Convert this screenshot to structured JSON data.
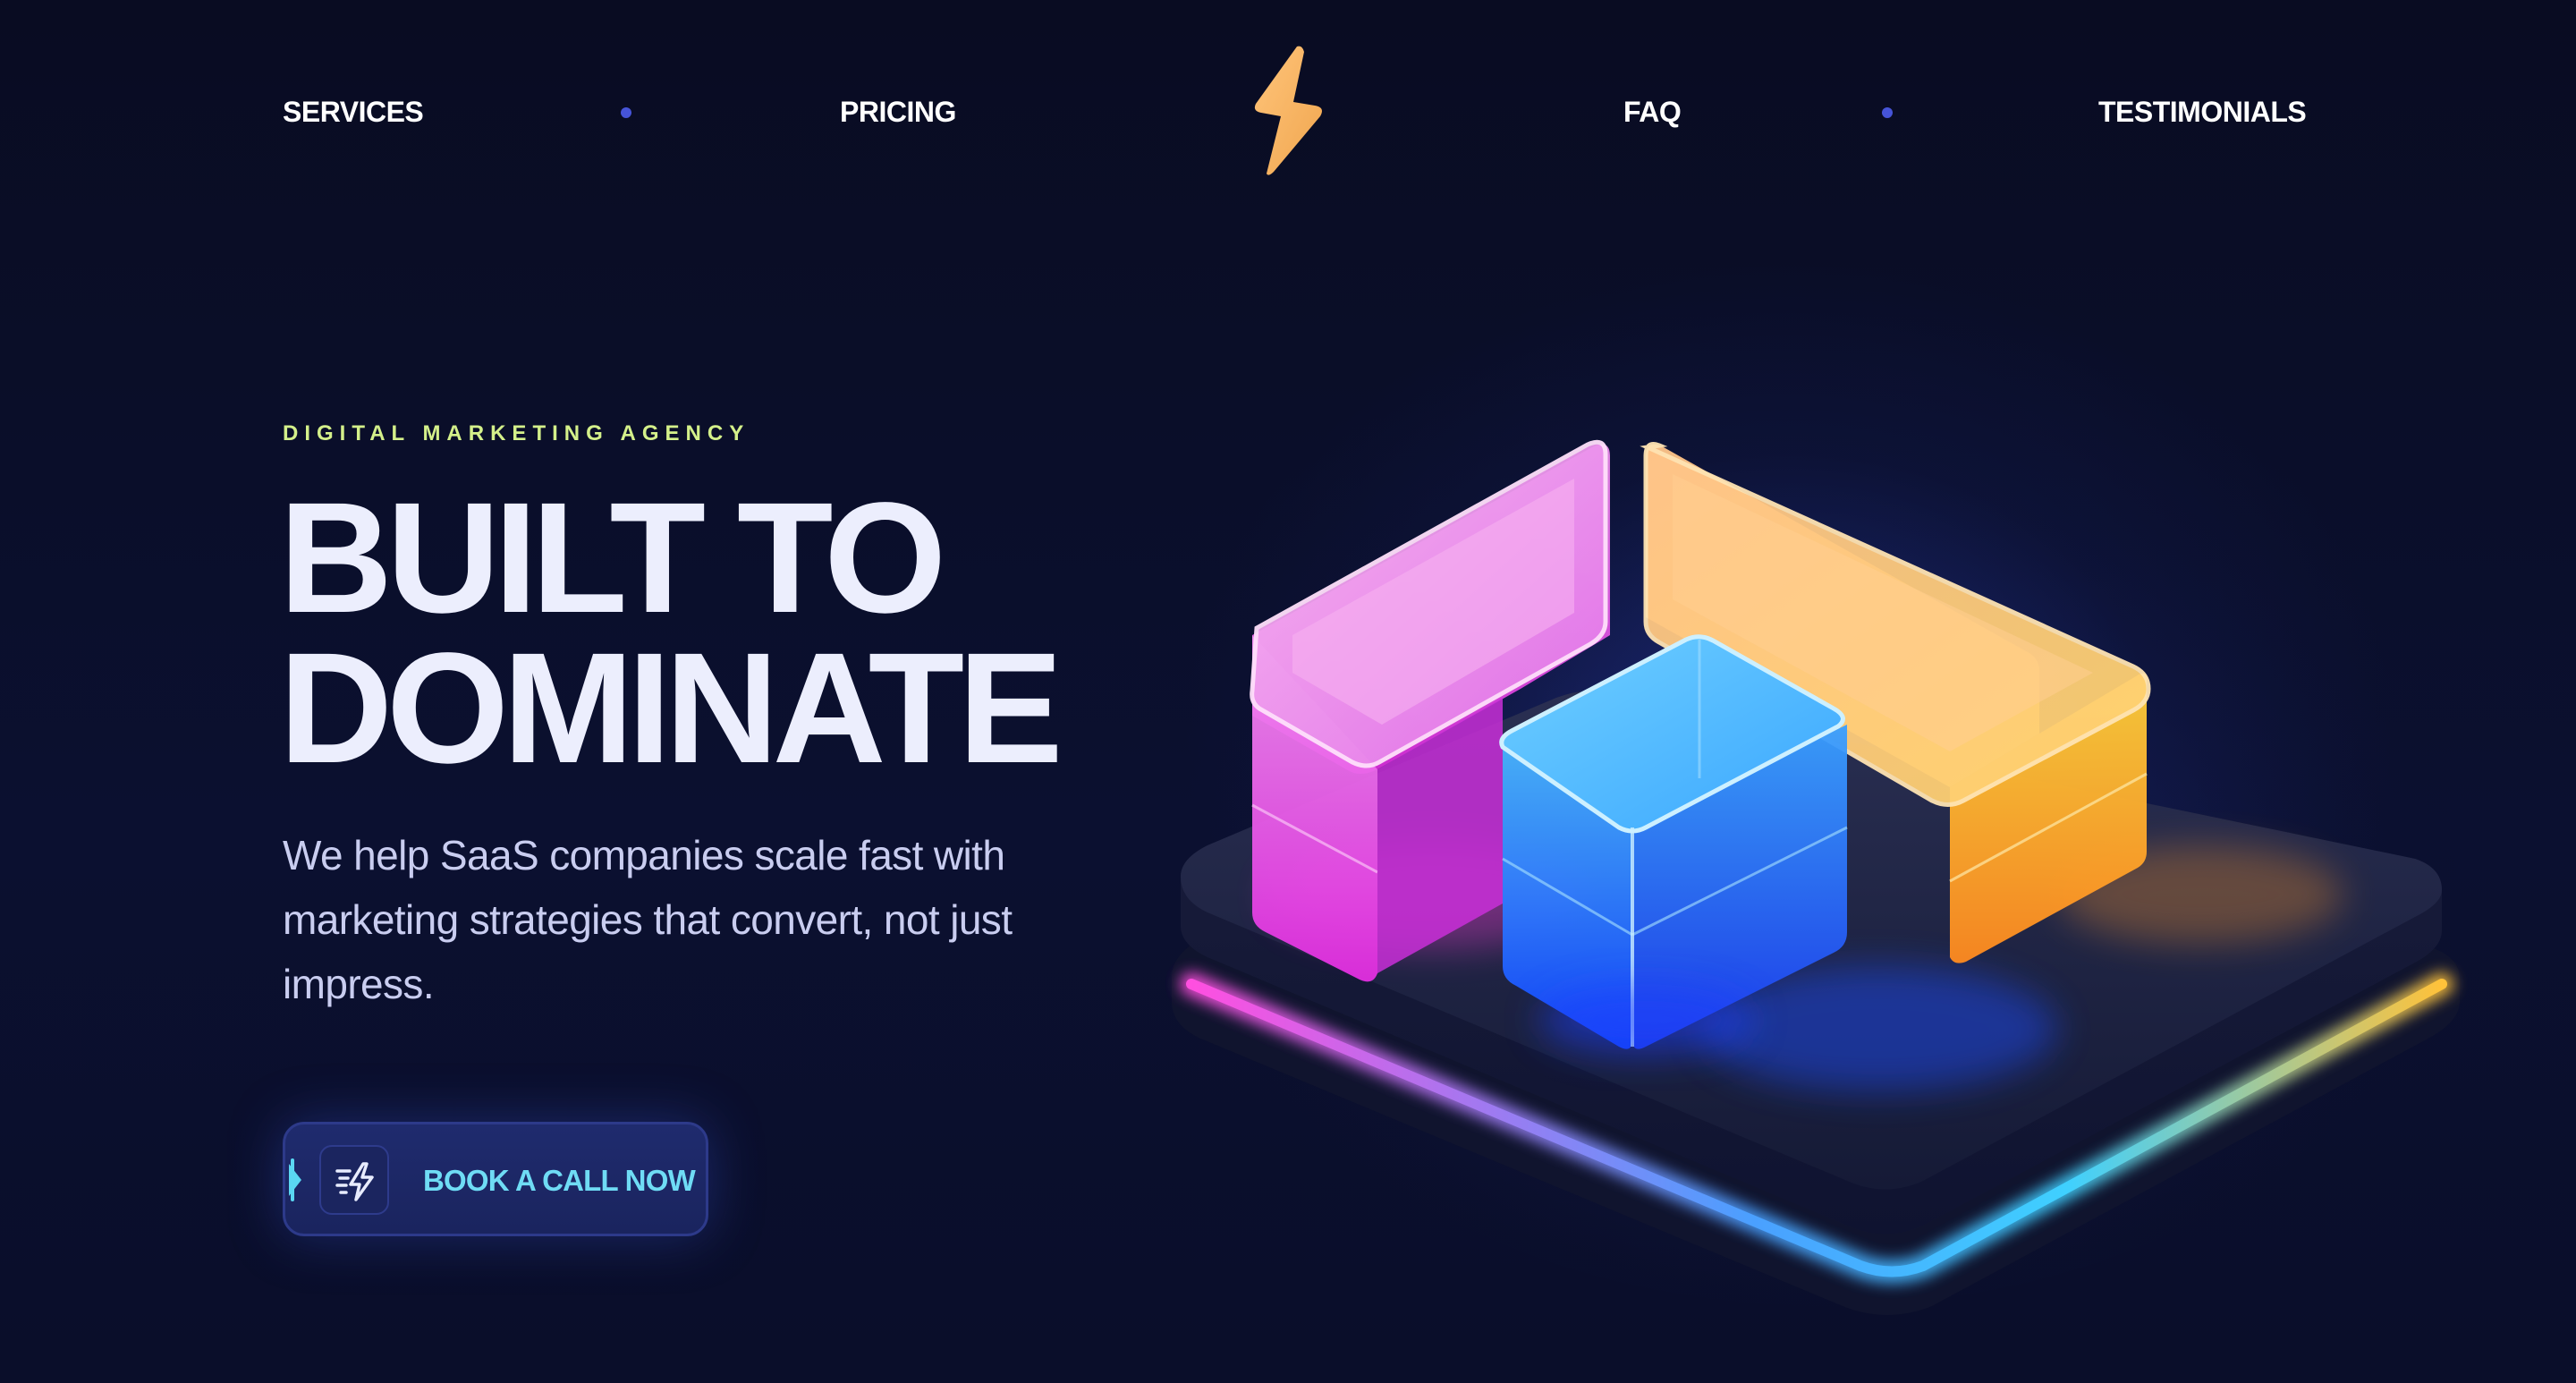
{
  "nav": {
    "left_links": [
      "SERVICES",
      "PRICING"
    ],
    "right_links": [
      "FAQ",
      "TESTIMONIALS"
    ],
    "logo_icon": "lightning-bolt-icon",
    "logo_color": "#f6b968",
    "separator_color": "#4654d8"
  },
  "hero": {
    "eyebrow": "DIGITAL MARKETING AGENCY",
    "headline_line1": "BUILT TO",
    "headline_line2": "DOMINATE",
    "subcopy": "We help SaaS companies scale fast with marketing strategies that convert, not just impress.",
    "cta": {
      "label": "BOOK A CALL NOW",
      "icon": "fast-bolt-icon"
    }
  },
  "illustration": {
    "name": "glass-blocks-chart-illustration",
    "colors": {
      "pink": "#ff5ce6",
      "orange": "#ffb347",
      "blue": "#2f7dff",
      "base": "#151a3a"
    }
  },
  "colors": {
    "background": "#0a0e27",
    "eyebrow": "#d4f08a",
    "headline": "#eceefd",
    "subcopy": "#c9cdf0",
    "cta_text": "#6fdcf5",
    "cta_bg": "#1f2b6e"
  }
}
